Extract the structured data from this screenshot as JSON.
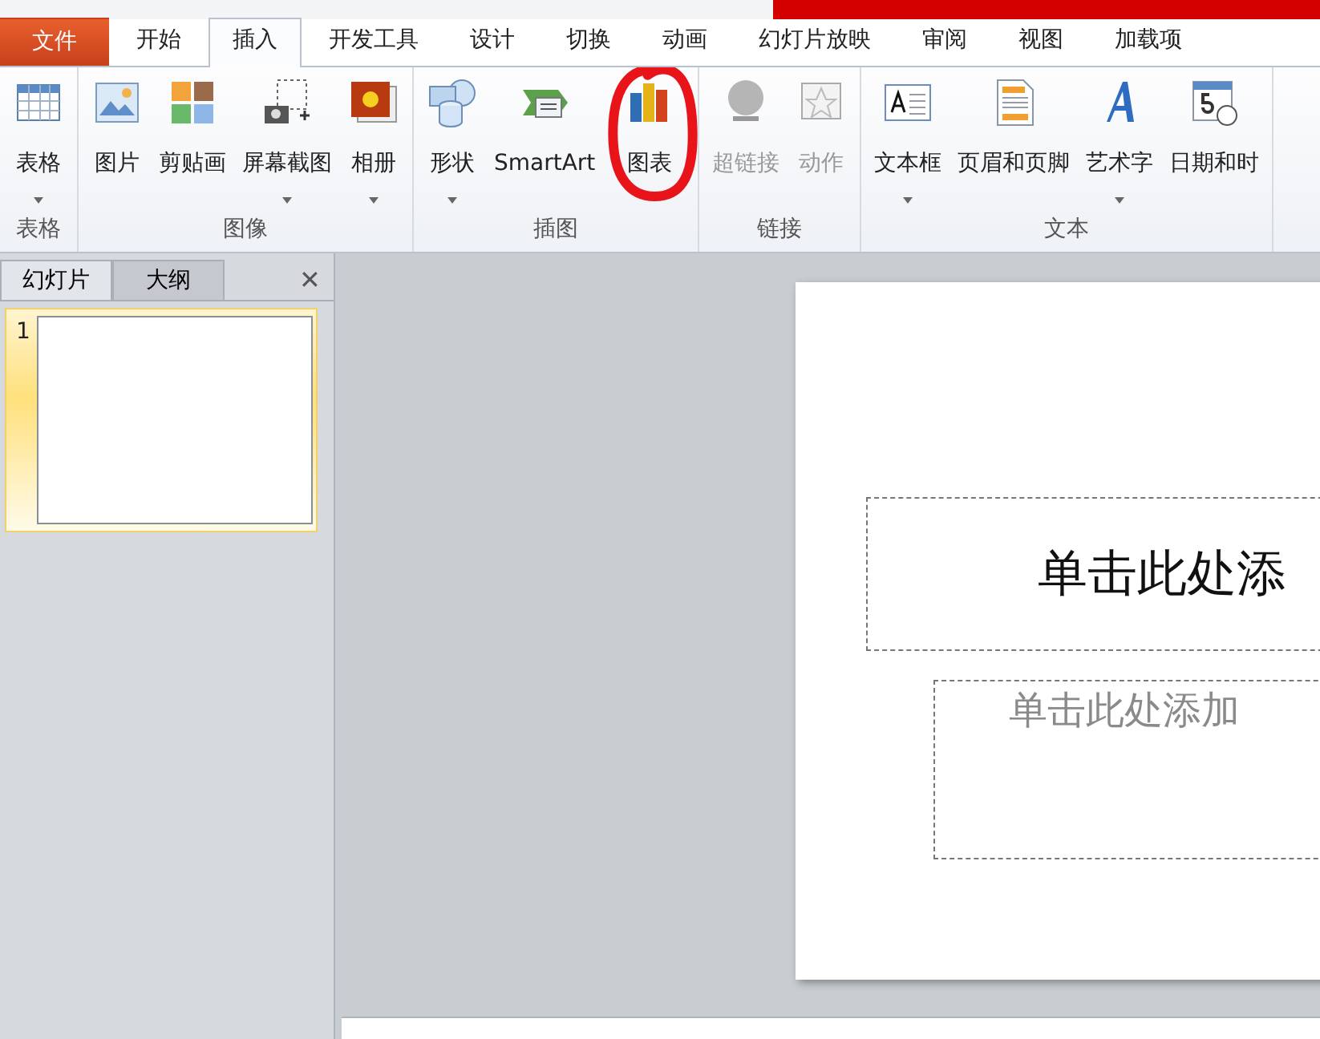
{
  "tabs": [
    {
      "label": "文件",
      "kind": "file",
      "selected": false
    },
    {
      "label": "开始",
      "kind": "tab",
      "selected": false
    },
    {
      "label": "插入",
      "kind": "tab",
      "selected": true
    },
    {
      "label": "开发工具",
      "kind": "tab",
      "selected": false
    },
    {
      "label": "设计",
      "kind": "tab",
      "selected": false
    },
    {
      "label": "切换",
      "kind": "tab",
      "selected": false
    },
    {
      "label": "动画",
      "kind": "tab",
      "selected": false
    },
    {
      "label": "幻灯片放映",
      "kind": "tab",
      "selected": false
    },
    {
      "label": "审阅",
      "kind": "tab",
      "selected": false
    },
    {
      "label": "视图",
      "kind": "tab",
      "selected": false
    },
    {
      "label": "加载项",
      "kind": "tab",
      "selected": false
    }
  ],
  "ribbon_groups": [
    {
      "label": "表格",
      "buttons": [
        {
          "label": "表格",
          "dropdown": true,
          "disabled": false,
          "circled": false
        }
      ]
    },
    {
      "label": "图像",
      "buttons": [
        {
          "label": "图片",
          "dropdown": false,
          "disabled": false,
          "circled": false
        },
        {
          "label": "剪贴画",
          "dropdown": false,
          "disabled": false,
          "circled": false
        },
        {
          "label": "屏幕截图",
          "dropdown": true,
          "disabled": false,
          "circled": false
        },
        {
          "label": "相册",
          "dropdown": true,
          "disabled": false,
          "circled": false
        }
      ]
    },
    {
      "label": "插图",
      "buttons": [
        {
          "label": "形状",
          "dropdown": true,
          "disabled": false,
          "circled": false
        },
        {
          "label": "SmartArt",
          "dropdown": false,
          "disabled": false,
          "circled": false
        },
        {
          "label": "图表",
          "dropdown": false,
          "disabled": false,
          "circled": true
        }
      ]
    },
    {
      "label": "链接",
      "buttons": [
        {
          "label": "超链接",
          "dropdown": false,
          "disabled": true,
          "circled": false
        },
        {
          "label": "动作",
          "dropdown": false,
          "disabled": true,
          "circled": false
        }
      ]
    },
    {
      "label": "文本",
      "buttons": [
        {
          "label": "文本框",
          "dropdown": true,
          "disabled": false,
          "circled": false
        },
        {
          "label": "页眉和页脚",
          "dropdown": false,
          "disabled": false,
          "circled": false
        },
        {
          "label": "艺术字",
          "dropdown": true,
          "disabled": false,
          "circled": false
        },
        {
          "label": "日期和时",
          "dropdown": false,
          "disabled": false,
          "circled": false
        }
      ]
    }
  ],
  "pane_tabs": [
    {
      "label": "幻灯片",
      "selected": true
    },
    {
      "label": "大纲",
      "selected": false
    }
  ],
  "pane_close": "✕",
  "slides": [
    {
      "number": "1",
      "selected": true
    }
  ],
  "slide": {
    "title_placeholder": "单击此处添",
    "subtitle_placeholder": "单击此处添加"
  }
}
